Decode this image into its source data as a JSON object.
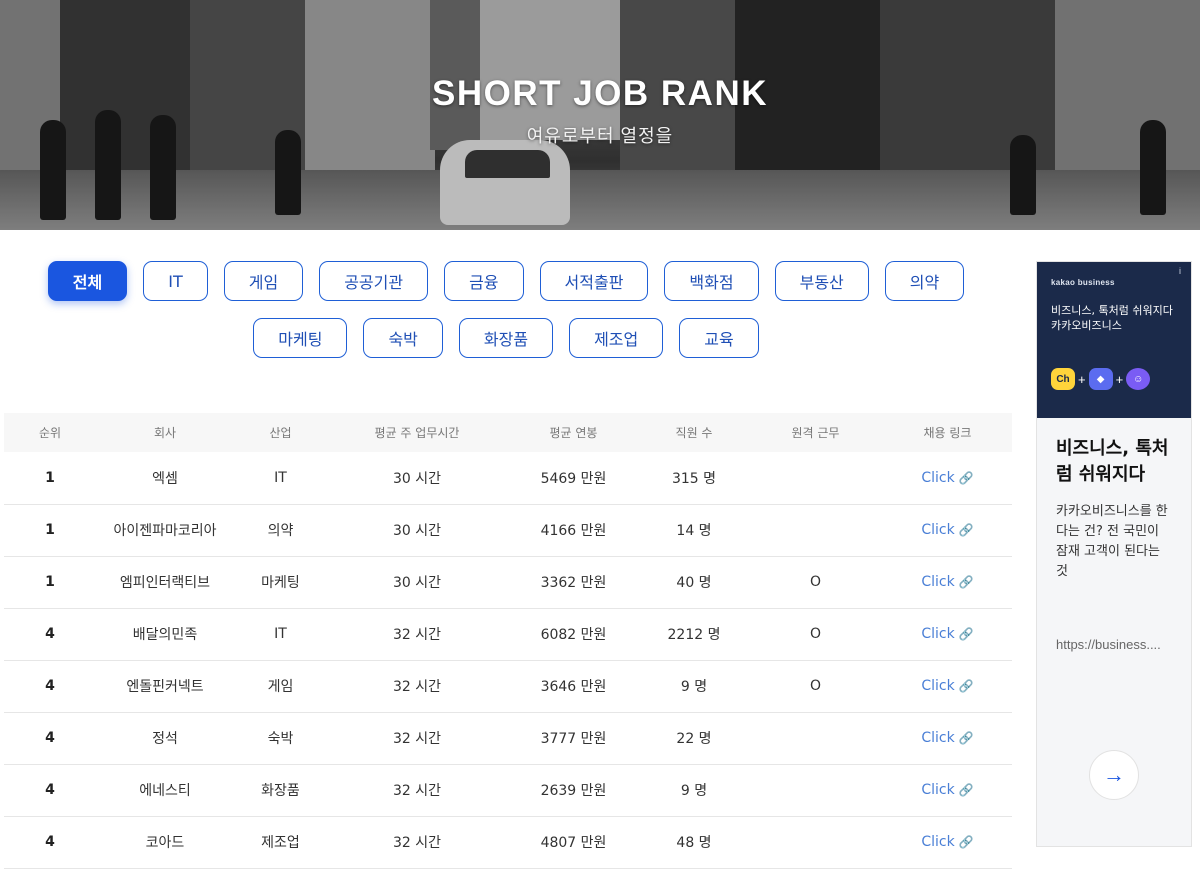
{
  "hero": {
    "title": "SHORT JOB RANK",
    "subtitle": "여유로부터 열정을"
  },
  "filters": {
    "row1": [
      "전체",
      "IT",
      "게임",
      "공공기관",
      "금융",
      "서적출판",
      "백화점",
      "부동산",
      "의약"
    ],
    "row2": [
      "마케팅",
      "숙박",
      "화장품",
      "제조업",
      "교육"
    ],
    "active": "전체"
  },
  "table": {
    "headers": [
      "순위",
      "회사",
      "산업",
      "평균 주 업무시간",
      "평균 연봉",
      "직원 수",
      "원격 근무",
      "채용 링크"
    ],
    "rows": [
      {
        "rank": "1",
        "company": "엑셈",
        "industry": "IT",
        "hours": "30 시간",
        "salary": "5469 만원",
        "employees": "315 명",
        "remote": "",
        "link": "Click"
      },
      {
        "rank": "1",
        "company": "아이젠파마코리아",
        "industry": "의약",
        "hours": "30 시간",
        "salary": "4166 만원",
        "employees": "14 명",
        "remote": "",
        "link": "Click"
      },
      {
        "rank": "1",
        "company": "엠피인터랙티브",
        "industry": "마케팅",
        "hours": "30 시간",
        "salary": "3362 만원",
        "employees": "40 명",
        "remote": "O",
        "link": "Click"
      },
      {
        "rank": "4",
        "company": "배달의민족",
        "industry": "IT",
        "hours": "32 시간",
        "salary": "6082 만원",
        "employees": "2212 명",
        "remote": "O",
        "link": "Click"
      },
      {
        "rank": "4",
        "company": "엔돌핀커넥트",
        "industry": "게임",
        "hours": "32 시간",
        "salary": "3646 만원",
        "employees": "9 명",
        "remote": "O",
        "link": "Click"
      },
      {
        "rank": "4",
        "company": "정석",
        "industry": "숙박",
        "hours": "32 시간",
        "salary": "3777 만원",
        "employees": "22 명",
        "remote": "",
        "link": "Click"
      },
      {
        "rank": "4",
        "company": "에네스티",
        "industry": "화장품",
        "hours": "32 시간",
        "salary": "2639 만원",
        "employees": "9 명",
        "remote": "",
        "link": "Click"
      },
      {
        "rank": "4",
        "company": "코아드",
        "industry": "제조업",
        "hours": "32 시간",
        "salary": "4807 만원",
        "employees": "48 명",
        "remote": "",
        "link": "Click"
      }
    ]
  },
  "ad": {
    "brand": "kakao business",
    "info": "i",
    "headline_line1": "비즈니스, 톡처럼 쉬워지다",
    "headline_line2": "카카오비즈니스",
    "badge_ch": "Ch",
    "title": "비즈니스, 톡처럼 쉬워지다",
    "description": "카카오비즈니스를 한다는 건? 전 국민이 잠재 고객이 된다는 것",
    "url": "https://business....",
    "arrow": "→"
  }
}
